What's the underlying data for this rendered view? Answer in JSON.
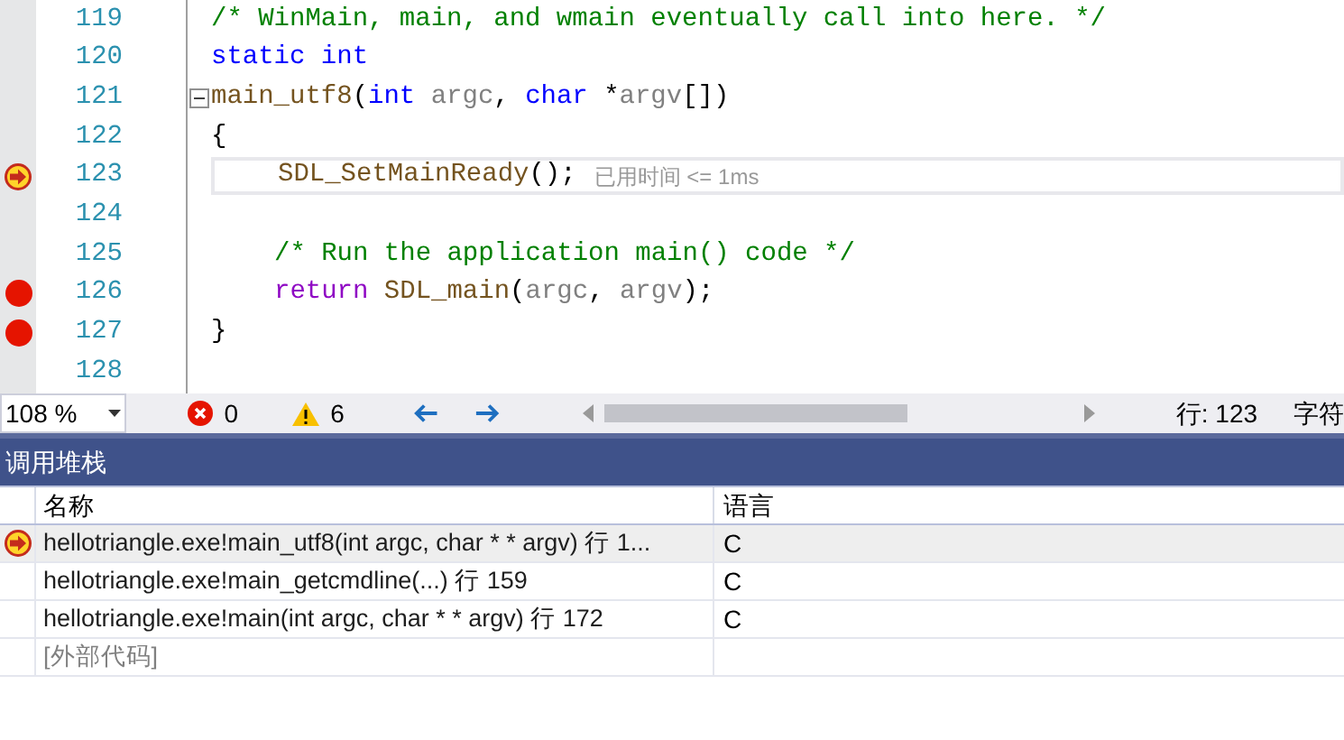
{
  "editor": {
    "lines": [
      {
        "number": "119",
        "breakpoint": false,
        "current": false,
        "fold": false,
        "tokens": [
          {
            "kind": "comment",
            "text": "/* WinMain, main, and wmain eventually call into here. */"
          }
        ]
      },
      {
        "number": "120",
        "breakpoint": false,
        "current": false,
        "fold": false,
        "tokens": [
          {
            "kind": "keyword",
            "text": "static int"
          }
        ]
      },
      {
        "number": "121",
        "breakpoint": false,
        "current": false,
        "fold": true,
        "tokens": [
          {
            "kind": "func",
            "text": "main_utf8"
          },
          {
            "kind": "plain",
            "text": "("
          },
          {
            "kind": "keyword",
            "text": "int"
          },
          {
            "kind": "param",
            "text": " argc"
          },
          {
            "kind": "plain",
            "text": ", "
          },
          {
            "kind": "keyword",
            "text": "char"
          },
          {
            "kind": "plain",
            "text": " *"
          },
          {
            "kind": "param",
            "text": "argv"
          },
          {
            "kind": "plain",
            "text": "[])"
          }
        ]
      },
      {
        "number": "122",
        "breakpoint": false,
        "current": false,
        "fold": false,
        "tokens": [
          {
            "kind": "plain",
            "text": "{"
          }
        ]
      },
      {
        "number": "123",
        "breakpoint": false,
        "current": true,
        "fold": false,
        "indented": true,
        "hint": "已用时间 <= 1ms",
        "tokens": [
          {
            "kind": "func",
            "text": "SDL_SetMainReady"
          },
          {
            "kind": "plain",
            "text": "();"
          }
        ]
      },
      {
        "number": "124",
        "breakpoint": false,
        "current": false,
        "fold": false
      },
      {
        "number": "125",
        "breakpoint": false,
        "current": false,
        "fold": false,
        "indented": true,
        "tokens": [
          {
            "kind": "comment",
            "text": "/* Run the application main() code */"
          }
        ]
      },
      {
        "number": "126",
        "breakpoint": true,
        "current": false,
        "fold": false,
        "indented": true,
        "tokens": [
          {
            "kind": "control",
            "text": "return"
          },
          {
            "kind": "func",
            "text": " SDL_main"
          },
          {
            "kind": "plain",
            "text": "("
          },
          {
            "kind": "param",
            "text": "argc"
          },
          {
            "kind": "plain",
            "text": ", "
          },
          {
            "kind": "param",
            "text": "argv"
          },
          {
            "kind": "plain",
            "text": ");"
          }
        ]
      },
      {
        "number": "127",
        "breakpoint": true,
        "current": false,
        "fold": false,
        "tokens": [
          {
            "kind": "plain",
            "text": "}"
          }
        ]
      },
      {
        "number": "128",
        "breakpoint": false,
        "current": false,
        "fold": false
      }
    ]
  },
  "status_bar": {
    "zoom": "108 %",
    "errors": "0",
    "warnings": "6",
    "line": "行: 123",
    "column": "字符"
  },
  "call_stack": {
    "title": "调用堆栈",
    "columns": [
      "名称",
      "语言"
    ],
    "rows": [
      {
        "kind": "frame",
        "name": "hellotriangle.exe!main_utf8(int argc, char * * argv) 行 1...",
        "language": "C",
        "current": true,
        "selected": true
      },
      {
        "kind": "frame",
        "name": "hellotriangle.exe!main_getcmdline(...) 行 159",
        "language": "C",
        "current": false,
        "selected": false
      },
      {
        "kind": "frame",
        "name": "hellotriangle.exe!main(int argc, char * * argv) 行 172",
        "language": "C",
        "current": false,
        "selected": false
      },
      {
        "kind": "external",
        "name": "[外部代码]",
        "current": false,
        "selected": false
      }
    ]
  }
}
